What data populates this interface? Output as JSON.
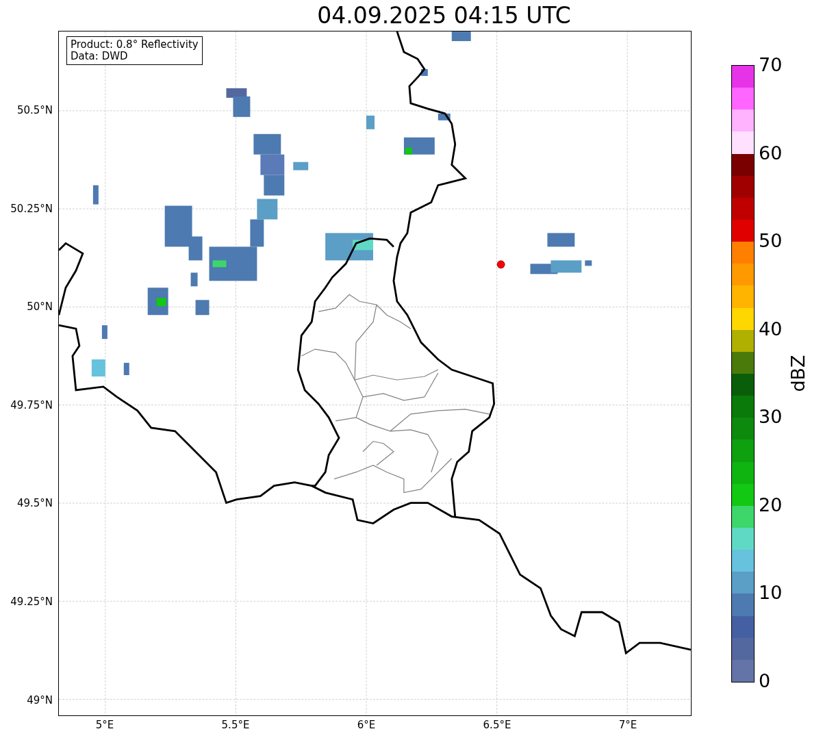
{
  "title": "04.09.2025 04:15 UTC",
  "info_box": {
    "lines": [
      "Product: 0.8° Reflectivity",
      "Data: DWD"
    ]
  },
  "map": {
    "lat_labels": [
      "50.5°N",
      "50.25°N",
      "50°N",
      "49.75°N",
      "49.5°N",
      "49.25°N",
      "49°N"
    ],
    "lon_labels": [
      "5°E",
      "5.5°E",
      "6°E",
      "6.5°E",
      "7°E"
    ]
  },
  "colorbar": {
    "label": "dBZ",
    "ticks": [
      "70",
      "60",
      "50",
      "40",
      "30",
      "20",
      "10",
      "0"
    ],
    "bins": [
      {
        "color": "#e633e8"
      },
      {
        "color": "#ff66ff"
      },
      {
        "color": "#ffb3ff"
      },
      {
        "color": "#ffe0ff"
      },
      {
        "color": "#7a0000"
      },
      {
        "color": "#a00000"
      },
      {
        "color": "#c00000"
      },
      {
        "color": "#e00000"
      },
      {
        "color": "#ff7f00"
      },
      {
        "color": "#ff9900"
      },
      {
        "color": "#ffb400"
      },
      {
        "color": "#ffd700"
      },
      {
        "color": "#b0b000"
      },
      {
        "color": "#4a7a0a"
      },
      {
        "color": "#0a5e0a"
      },
      {
        "color": "#0a7a0a"
      },
      {
        "color": "#0d8a0d"
      },
      {
        "color": "#0ea00e"
      },
      {
        "color": "#10b410"
      },
      {
        "color": "#12c812"
      },
      {
        "color": "#3dd66b"
      },
      {
        "color": "#60d9c4"
      },
      {
        "color": "#66c2dd"
      },
      {
        "color": "#5b9ec6"
      },
      {
        "color": "#4d7ab0"
      },
      {
        "color": "#4560a2"
      },
      {
        "color": "#5468a0"
      },
      {
        "color": "#6574a8"
      }
    ]
  }
}
